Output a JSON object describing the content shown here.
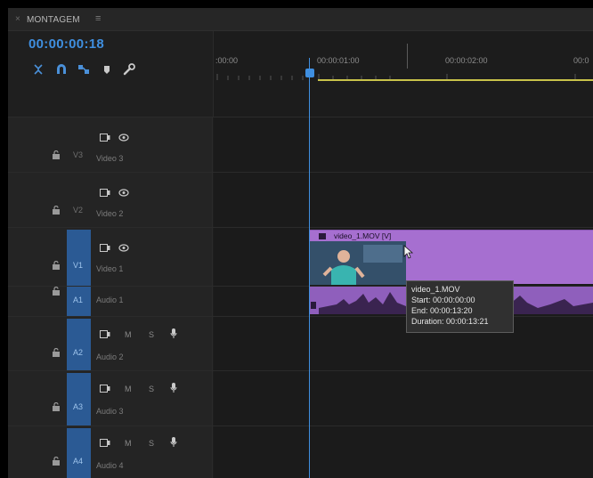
{
  "panel": {
    "close_glyph": "×",
    "title": "MONTAGEM",
    "menu_glyph": "≡"
  },
  "sequence": {
    "timecode": "00:00:00:18",
    "accent_color": "#3f8fe0",
    "clip_color": "#a66fd0"
  },
  "tools": [
    "insert-nest-icon",
    "snap-magnet-icon",
    "linked-selection-icon",
    "add-marker-icon",
    "timeline-settings-wrench-icon"
  ],
  "ruler": {
    "labels": [
      ":00:00",
      "00:00:01:00",
      "00:00:02:00",
      "00:0"
    ]
  },
  "tracks": {
    "v3": {
      "id": "V3",
      "name": "Video 3"
    },
    "v2": {
      "id": "V2",
      "name": "Video 2"
    },
    "v1": {
      "id": "V1",
      "name": "Video 1"
    },
    "a1": {
      "id": "A1",
      "name": "Audio 1"
    },
    "a2": {
      "id": "A2",
      "name": "Audio 2",
      "m": "M",
      "s": "S"
    },
    "a3": {
      "id": "A3",
      "name": "Audio 3",
      "m": "M",
      "s": "S"
    },
    "a4": {
      "id": "A4",
      "name": "Audio 4",
      "m": "M",
      "s": "S"
    }
  },
  "clip": {
    "title": "video_1.MOV [V]",
    "tooltip": {
      "name": "video_1.MOV",
      "start": "Start: 00:00:00:00",
      "end": "End: 00:00:13:20",
      "duration": "Duration: 00:00:13:21"
    }
  }
}
